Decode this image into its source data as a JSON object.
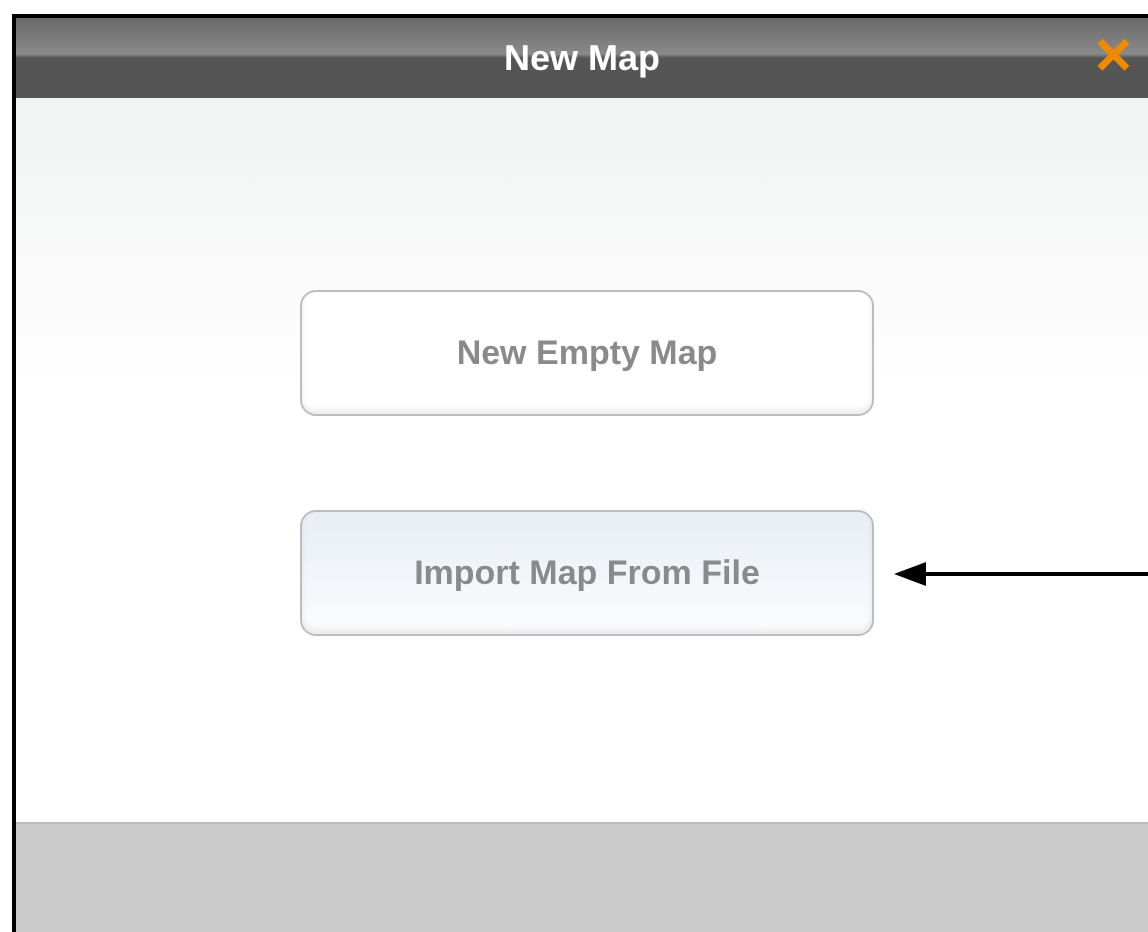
{
  "window": {
    "title": "New Map",
    "close": "×"
  },
  "buttons": [
    {
      "label": "New Empty Map",
      "hovered": false
    },
    {
      "label": "Import Map From File",
      "hovered": true
    }
  ]
}
